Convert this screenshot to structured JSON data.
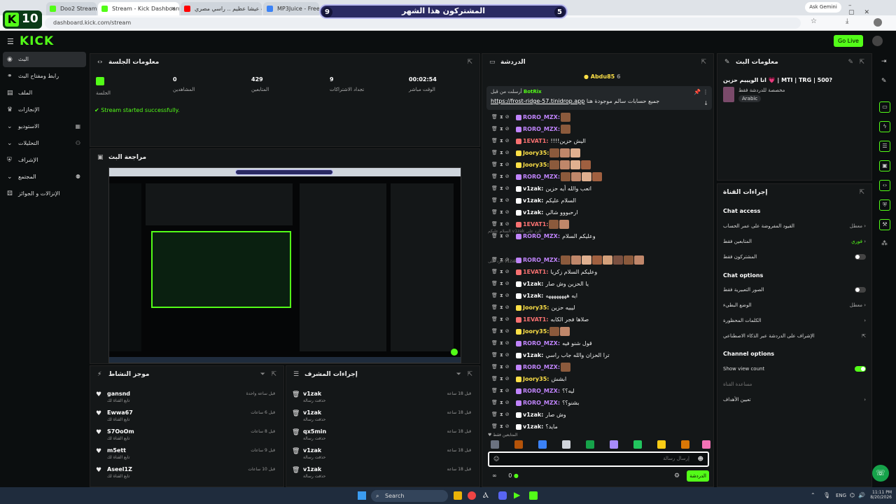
{
  "browser": {
    "tabs": [
      {
        "label": "Doo2 Stream - Watch Live on",
        "color": "#53fc18"
      },
      {
        "label": "Stream - Kick Dashboard",
        "color": "#53fc18"
      },
      {
        "label": "الحب عيشا عظيم .. راسي مصري",
        "color": "#ff0000"
      },
      {
        "label": "MP3Juice - Free MP3 Juic",
        "color": "#3b82f6"
      }
    ],
    "url": "dashboard.kick.com/stream",
    "ask_gemini": "Ask Gemini"
  },
  "overlay": {
    "k_label": "K",
    "k_count": "10",
    "sub_banner": "المشتركون هذا الشهر",
    "left_num": "9",
    "right_num": "5"
  },
  "kick": {
    "logo": "KICK",
    "go_live": "Go Live"
  },
  "sidebar": {
    "items": [
      {
        "label": "البث",
        "icon": "broadcast-icon"
      },
      {
        "label": "رابط ومفتاح البث",
        "icon": "link-icon"
      },
      {
        "label": "الملف",
        "icon": "file-icon"
      },
      {
        "label": "الإنجازات",
        "icon": "trophy-icon"
      },
      {
        "label": "الاستوديو",
        "icon": "studio-icon"
      },
      {
        "label": "التحليلات",
        "icon": "analytics-icon"
      },
      {
        "label": "الإشراف",
        "icon": "shield-icon"
      },
      {
        "label": "المجتمع",
        "icon": "community-icon"
      },
      {
        "label": "الإنزالات و الجوائز",
        "icon": "gift-icon"
      }
    ]
  },
  "session": {
    "title": "معلومات الجلسة",
    "live_label": "الجلسة",
    "stats": [
      {
        "value": "0",
        "label": "المشاهدين"
      },
      {
        "value": "429",
        "label": "المتابعين"
      },
      {
        "value": "9",
        "label": "تجداد الاشتراكات"
      },
      {
        "value": "00:02:54",
        "label": "الوقت مباشر"
      }
    ],
    "status": "Stream started successfully."
  },
  "preview": {
    "title": "مراجعة البث"
  },
  "activity": {
    "title": "موجز النشاط",
    "items": [
      {
        "name": "gansnd",
        "sub": "تابع القناة لك",
        "time": "قبل ساعة واحدة"
      },
      {
        "name": "Ewwa67",
        "sub": "تابع القناة لك",
        "time": "قبل 6 ساعات"
      },
      {
        "name": "S7OoOm",
        "sub": "تابع القناة لك",
        "time": "قبل 8 ساعات"
      },
      {
        "name": "m5ett",
        "sub": "تابع القناة لك",
        "time": "قبل 9 ساعات"
      },
      {
        "name": "Aseel1Z",
        "sub": "تابع القناة لك",
        "time": "قبل 10 ساعات"
      }
    ]
  },
  "mod": {
    "title": "إجراءات المشرف",
    "items": [
      {
        "name": "v1zak",
        "sub": "حذفت رسالة",
        "time": "قبل 18 ساعة"
      },
      {
        "name": "v1zak",
        "sub": "حذفت رسالة",
        "time": "قبل 18 ساعة"
      },
      {
        "name": "qx5min",
        "sub": "حذفت رسالة",
        "time": "قبل 18 ساعة"
      },
      {
        "name": "v1zak",
        "sub": "حذفت رسالة",
        "time": "قبل 18 ساعة"
      },
      {
        "name": "v1zak",
        "sub": "حذفت رسالة",
        "time": "قبل 18 ساعة"
      }
    ]
  },
  "chat": {
    "title": "الدردشة",
    "top_user": "Abdu85",
    "top_count": "6",
    "pinned_by": "BotRix",
    "pinned_label": "أرسلت من قبل",
    "pinned_link": "https://frost-ridge-57.tinidrop.app",
    "pinned_text": "جميع حسابات سالم موجودة هنا",
    "messages": [
      {
        "user": "RORO_MZX:",
        "color": "#c084fc",
        "text": "",
        "emotes": 1
      },
      {
        "user": "RORO_MZX:",
        "color": "#c084fc",
        "text": "",
        "emotes": 1
      },
      {
        "user": "1EVAT1:",
        "color": "#f87171",
        "text": "!!!!اليش حزين",
        "emotes": 0
      },
      {
        "user": "Joory35:",
        "color": "#fde047",
        "text": "",
        "emotes": 3
      },
      {
        "user": "Joory35:",
        "color": "#fde047",
        "text": "",
        "emotes": 4
      },
      {
        "user": "RORO_MZX:",
        "color": "#c084fc",
        "text": "",
        "emotes": 4
      },
      {
        "user": "v1zak:",
        "color": "#fff",
        "text": "اتعب والله أيه حزين",
        "emotes": 0
      },
      {
        "user": "v1zak:",
        "color": "#fff",
        "text": "السلام عليكم",
        "emotes": 0
      },
      {
        "user": "v1zak:",
        "color": "#fff",
        "text": "ارحبووو شالي",
        "emotes": 0
      },
      {
        "user": "1EVAT1:",
        "color": "#f87171",
        "text": "",
        "emotes": 2
      },
      {
        "user": "RORO_MZX:",
        "color": "#c084fc",
        "text": "وعليكم السلام",
        "emotes": 0
      },
      {
        "user": "RORO_MZX:",
        "color": "#c084fc",
        "text": "",
        "emotes": 8
      },
      {
        "user": "1EVAT1:",
        "color": "#f87171",
        "text": "وعليكم السلام زكريا",
        "emotes": 0
      },
      {
        "user": "v1zak:",
        "color": "#fff",
        "text": "يا الحزين وش صار",
        "emotes": 0
      },
      {
        "user": "v1zak:",
        "color": "#fff",
        "text": "ايه ههههههههه",
        "emotes": 0
      },
      {
        "user": "Joory35:",
        "color": "#fde047",
        "text": "ليييه حزين",
        "emotes": 0
      },
      {
        "user": "1EVAT1:",
        "color": "#f87171",
        "text": "صلاها فجر الكابه",
        "emotes": 0
      },
      {
        "user": "Joory35:",
        "color": "#fde047",
        "text": "",
        "emotes": 2
      },
      {
        "user": "RORO_MZX:",
        "color": "#c084fc",
        "text": "قول شنو فيه",
        "emotes": 0
      },
      {
        "user": "v1zak:",
        "color": "#fff",
        "text": "ترا الحزان والله جاب راسي",
        "emotes": 0
      },
      {
        "user": "RORO_MZX:",
        "color": "#c084fc",
        "text": "",
        "emotes": 1
      },
      {
        "user": "Joory35:",
        "color": "#fde047",
        "text": "ابشش",
        "emotes": 0
      },
      {
        "user": "RORO_MZX:",
        "color": "#c084fc",
        "text": "ليه؟؟",
        "emotes": 0
      },
      {
        "user": "RORO_MZX:",
        "color": "#c084fc",
        "text": "بشنو؟؟",
        "emotes": 0
      },
      {
        "user": "v1zak:",
        "color": "#fff",
        "text": "وش صار",
        "emotes": 0
      },
      {
        "user": "v1zak:",
        "color": "#fff",
        "text": "مايد؟",
        "emotes": 0
      }
    ],
    "sys1": "السلام عليكم v1zak الرد على",
    "sys2": "الرد على v1zak",
    "followers_only": "المتابعين فقط",
    "input_placeholder": "إرسال رسالة",
    "send_label": "الدردشة",
    "count": "0"
  },
  "stream_info": {
    "title": "معلومات البث",
    "stream_title": "انا الويييم حزين 💗 | MTI | TRG | 500?",
    "category": "مخصصة للدردشة فقط",
    "language": "Arabic"
  },
  "channel_actions": {
    "title": "إجراءات القناة",
    "chat_access": "Chat access",
    "access_rows": [
      {
        "label": "القيود المفروضة على عمر الحساب",
        "value": "معطل"
      },
      {
        "label": "المتابعين فقط",
        "value": "فوري"
      },
      {
        "label": "المشتركون فقط",
        "value": ""
      }
    ],
    "chat_options": "Chat options",
    "option_rows": [
      {
        "label": "الصور التعبيرية فقط",
        "value": ""
      },
      {
        "label": "الوضع البطيء",
        "value": "معطل"
      },
      {
        "label": "الكلمات المحظورة",
        "value": ""
      },
      {
        "label": "الإشراف على الدردشة عبر الذكاء الاصطناعي",
        "value": ""
      }
    ],
    "channel_options": "Channel options",
    "show_view_count": "Show view count",
    "channel_sub": "مساعدة القناة",
    "goals": "تعيين الأهداف"
  },
  "taskbar": {
    "search": "Search",
    "lang": "ENG",
    "time": "11:11 PM",
    "date": "8/20/2026"
  }
}
